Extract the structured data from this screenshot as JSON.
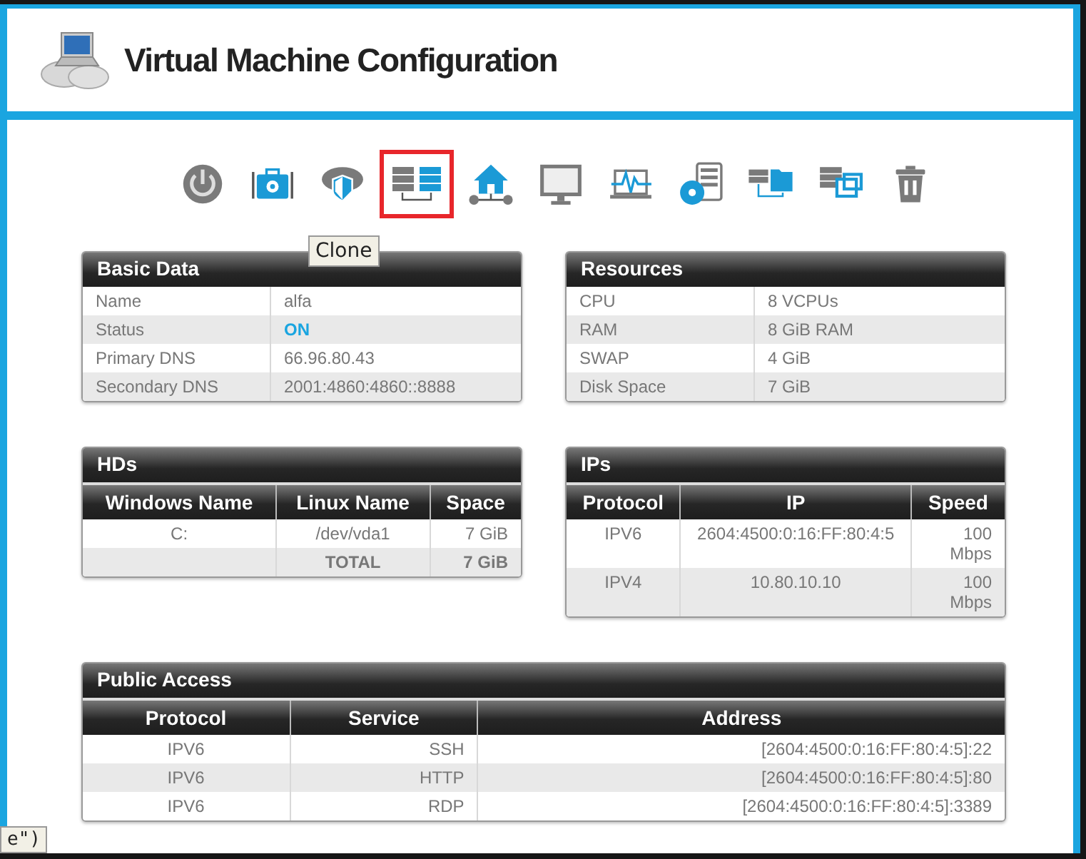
{
  "window": {
    "title": "Virtual Machine Configuration"
  },
  "toolbar": [
    {
      "kind": "power",
      "selected": false
    },
    {
      "kind": "toolbox",
      "selected": false
    },
    {
      "kind": "cloud-shield",
      "selected": false
    },
    {
      "kind": "clone",
      "selected": true
    },
    {
      "kind": "home-network",
      "selected": false
    },
    {
      "kind": "monitor",
      "selected": false
    },
    {
      "kind": "laptop-pulse",
      "selected": false
    },
    {
      "kind": "disc-server",
      "selected": false
    },
    {
      "kind": "server-folder",
      "selected": false
    },
    {
      "kind": "server-windows",
      "selected": false
    },
    {
      "kind": "trash",
      "selected": false
    }
  ],
  "tooltip": {
    "text": "Clone"
  },
  "basic_data": {
    "title": "Basic Data",
    "rows": [
      {
        "label": "Name",
        "value": "alfa"
      },
      {
        "label": "Status",
        "value": "ON",
        "kind": "status"
      },
      {
        "label": "Primary DNS",
        "value": "66.96.80.43"
      },
      {
        "label": "Secondary DNS",
        "value": "2001:4860:4860::8888"
      }
    ]
  },
  "resources": {
    "title": "Resources",
    "rows": [
      {
        "label": "CPU",
        "value": "8 VCPUs"
      },
      {
        "label": "RAM",
        "value": "8 GiB RAM"
      },
      {
        "label": "SWAP",
        "value": "4 GiB"
      },
      {
        "label": "Disk Space",
        "value": "7 GiB"
      }
    ]
  },
  "hds": {
    "title": "HDs",
    "columns": [
      "Windows Name",
      "Linux Name",
      "Space"
    ],
    "rows": [
      {
        "kind": "disk",
        "cells": [
          "C:",
          "/dev/vda1",
          "7 GiB"
        ]
      },
      {
        "kind": "total",
        "cells": [
          "",
          "TOTAL",
          "7 GiB"
        ]
      }
    ]
  },
  "ips": {
    "title": "IPs",
    "columns": [
      "Protocol",
      "IP",
      "Speed"
    ],
    "rows": [
      {
        "cells": [
          "IPV6",
          "2604:4500:0:16:FF:80:4:5",
          "100 Mbps"
        ]
      },
      {
        "cells": [
          "IPV4",
          "10.80.10.10",
          "100 Mbps"
        ]
      }
    ]
  },
  "public_access": {
    "title": "Public Access",
    "columns": [
      "Protocol",
      "Service",
      "Address"
    ],
    "rows": [
      {
        "cells": [
          "IPV6",
          "SSH",
          "[2604:4500:0:16:FF:80:4:5]:22"
        ]
      },
      {
        "cells": [
          "IPV6",
          "HTTP",
          "[2604:4500:0:16:FF:80:4:5]:80"
        ]
      },
      {
        "cells": [
          "IPV6",
          "RDP",
          "[2604:4500:0:16:FF:80:4:5]:3389"
        ]
      }
    ]
  },
  "status_hint": {
    "text": "e\")"
  }
}
